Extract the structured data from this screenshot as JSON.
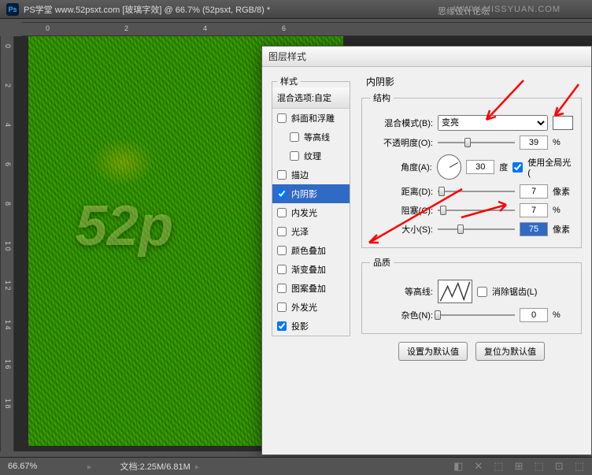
{
  "app": {
    "title": "PS学堂  www.52psxt.com [玻璃字效] @ 66.7% (52psxt, RGB/8) *",
    "icon_text": "Ps",
    "watermark1": "思缘设计论坛",
    "watermark2": "WWW.MISSYUAN.COM"
  },
  "ruler": {
    "h": [
      "0",
      "2",
      "4",
      "6"
    ],
    "v": [
      "0",
      "2",
      "4",
      "6",
      "8",
      "1\n0",
      "1\n2",
      "1\n4",
      "1\n6",
      "1\n8"
    ]
  },
  "canvas": {
    "text_overlay": "52p"
  },
  "status": {
    "zoom": "66.67%",
    "doc": "文档:2.25M/6.81M"
  },
  "dialog": {
    "title": "图层样式",
    "styles_legend": "样式",
    "blend_default": "混合选项:自定",
    "styles": [
      {
        "label": "斜面和浮雕",
        "checked": false,
        "indent": false
      },
      {
        "label": "等高线",
        "checked": false,
        "indent": true
      },
      {
        "label": "纹理",
        "checked": false,
        "indent": true
      },
      {
        "label": "描边",
        "checked": false,
        "indent": false
      },
      {
        "label": "内阴影",
        "checked": true,
        "indent": false,
        "selected": true
      },
      {
        "label": "内发光",
        "checked": false,
        "indent": false
      },
      {
        "label": "光泽",
        "checked": false,
        "indent": false
      },
      {
        "label": "颜色叠加",
        "checked": false,
        "indent": false
      },
      {
        "label": "渐变叠加",
        "checked": false,
        "indent": false
      },
      {
        "label": "图案叠加",
        "checked": false,
        "indent": false
      },
      {
        "label": "外发光",
        "checked": false,
        "indent": false
      },
      {
        "label": "投影",
        "checked": true,
        "indent": false
      }
    ],
    "panel_title": "内阴影",
    "structure_legend": "结构",
    "quality_legend": "品质",
    "blend_mode_label": "混合模式(B):",
    "blend_mode_value": "变亮",
    "opacity_label": "不透明度(O):",
    "opacity_value": "39",
    "opacity_unit": "%",
    "angle_label": "角度(A):",
    "angle_value": "30",
    "angle_unit": "度",
    "global_light_label": "使用全局光(",
    "distance_label": "距离(D):",
    "distance_value": "7",
    "distance_unit": "像素",
    "choke_label": "阻塞(C):",
    "choke_value": "7",
    "choke_unit": "%",
    "size_label": "大小(S):",
    "size_value": "75",
    "size_unit": "像素",
    "contour_label": "等高线:",
    "antialias_label": "消除锯齿(L)",
    "noise_label": "杂色(N):",
    "noise_value": "0",
    "noise_unit": "%",
    "btn_default": "设置为默认值",
    "btn_reset": "复位为默认值"
  }
}
